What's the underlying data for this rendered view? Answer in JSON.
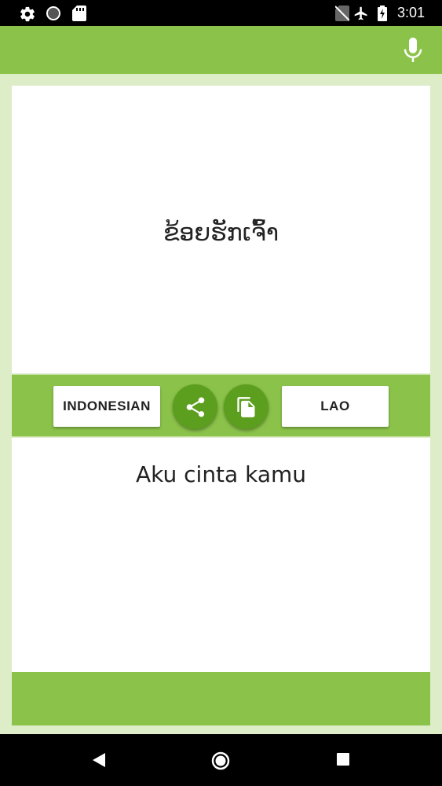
{
  "status_bar": {
    "time": "3:01",
    "icons": [
      "settings-icon",
      "circle-icon",
      "sd-card-icon",
      "no-sim-icon",
      "airplane-icon",
      "battery-charging-icon"
    ]
  },
  "app_bar": {
    "mic_icon": "microphone-icon"
  },
  "source": {
    "text": "ຂ້ອຍຮັກເຈົ້າ"
  },
  "toolbar": {
    "source_language": "INDONESIAN",
    "target_language": "LAO",
    "share_icon": "share-icon",
    "copy_icon": "copy-icon"
  },
  "target": {
    "text": "Aku cinta kamu"
  },
  "nav_bar": {
    "icons": [
      "back-icon",
      "home-icon",
      "recents-icon"
    ]
  },
  "colors": {
    "primary": "#8bc34a",
    "primary_dark": "#5c9e1e",
    "background": "#dcedc8"
  }
}
